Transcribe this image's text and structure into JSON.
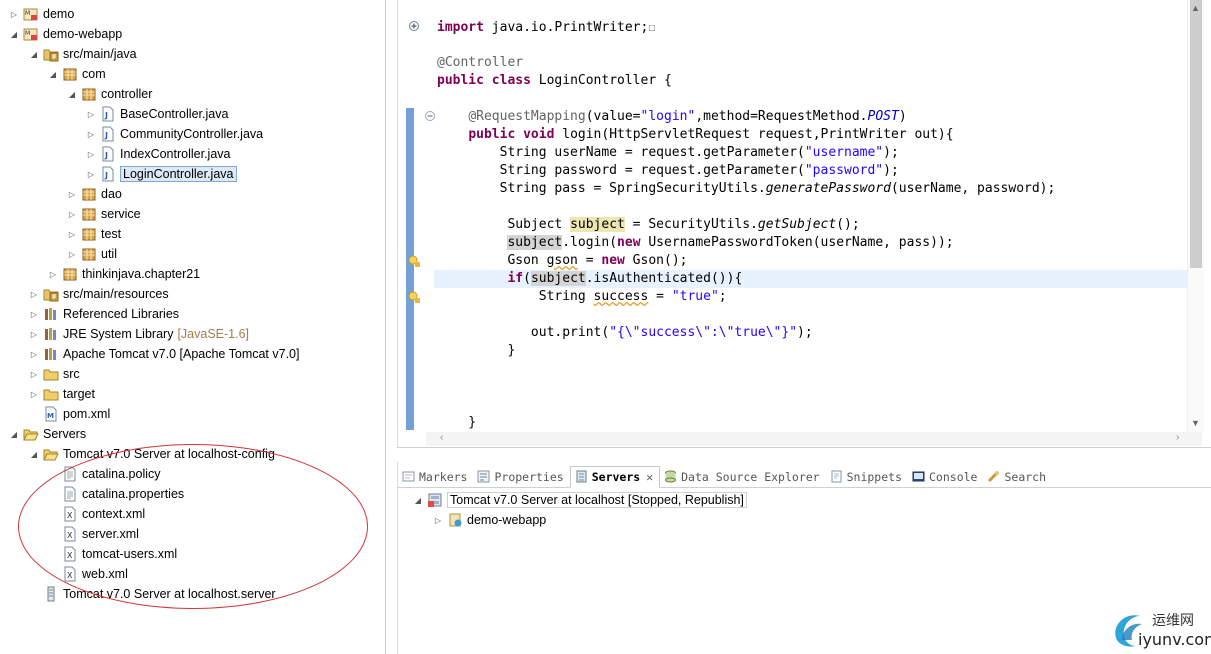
{
  "explorer": {
    "rows": [
      {
        "label": "demo",
        "indent": 0,
        "twisty": "collapsed",
        "icon": "maven-project-icon"
      },
      {
        "label": "demo-webapp",
        "indent": 0,
        "twisty": "expanded",
        "icon": "maven-project-icon"
      },
      {
        "label": "src/main/java",
        "indent": 1,
        "twisty": "expanded",
        "icon": "source-folder-icon"
      },
      {
        "label": "com",
        "indent": 2,
        "twisty": "expanded",
        "icon": "package-icon"
      },
      {
        "label": "controller",
        "indent": 3,
        "twisty": "expanded",
        "icon": "package-icon"
      },
      {
        "label": "BaseController.java",
        "indent": 4,
        "twisty": "collapsed",
        "icon": "java-file-icon"
      },
      {
        "label": "CommunityController.java",
        "indent": 4,
        "twisty": "collapsed",
        "icon": "java-file-icon"
      },
      {
        "label": "IndexController.java",
        "indent": 4,
        "twisty": "collapsed",
        "icon": "java-file-icon"
      },
      {
        "label": "LoginController.java",
        "indent": 4,
        "twisty": "collapsed",
        "icon": "java-file-icon",
        "selected": true
      },
      {
        "label": "dao",
        "indent": 3,
        "twisty": "collapsed",
        "icon": "package-icon"
      },
      {
        "label": "service",
        "indent": 3,
        "twisty": "collapsed",
        "icon": "package-icon"
      },
      {
        "label": "test",
        "indent": 3,
        "twisty": "collapsed",
        "icon": "package-icon"
      },
      {
        "label": "util",
        "indent": 3,
        "twisty": "collapsed",
        "icon": "package-icon"
      },
      {
        "label": "thinkinjava.chapter21",
        "indent": 2,
        "twisty": "collapsed",
        "icon": "package-icon"
      },
      {
        "label": "src/main/resources",
        "indent": 1,
        "twisty": "collapsed",
        "icon": "source-folder-icon"
      },
      {
        "label": "Referenced Libraries",
        "indent": 1,
        "twisty": "collapsed",
        "icon": "library-icon"
      },
      {
        "label": "JRE System Library",
        "decoration": "[JavaSE-1.6]",
        "indent": 1,
        "twisty": "collapsed",
        "icon": "library-icon"
      },
      {
        "label": "Apache Tomcat v7.0 [Apache Tomcat v7.0]",
        "indent": 1,
        "twisty": "collapsed",
        "icon": "library-icon"
      },
      {
        "label": "src",
        "indent": 1,
        "twisty": "collapsed",
        "icon": "folder-icon"
      },
      {
        "label": "target",
        "indent": 1,
        "twisty": "collapsed",
        "icon": "folder-icon"
      },
      {
        "label": "pom.xml",
        "indent": 1,
        "twisty": "none",
        "icon": "maven-pom-icon"
      },
      {
        "label": "Servers",
        "indent": 0,
        "twisty": "expanded",
        "icon": "open-folder-icon"
      },
      {
        "label": "Tomcat v7.0 Server at localhost-config",
        "indent": 1,
        "twisty": "expanded",
        "icon": "open-folder-icon"
      },
      {
        "label": "catalina.policy",
        "indent": 2,
        "twisty": "none",
        "icon": "text-file-icon"
      },
      {
        "label": "catalina.properties",
        "indent": 2,
        "twisty": "none",
        "icon": "text-file-icon"
      },
      {
        "label": "context.xml",
        "indent": 2,
        "twisty": "none",
        "icon": "xml-file-icon"
      },
      {
        "label": "server.xml",
        "indent": 2,
        "twisty": "none",
        "icon": "xml-file-icon"
      },
      {
        "label": "tomcat-users.xml",
        "indent": 2,
        "twisty": "none",
        "icon": "xml-file-icon"
      },
      {
        "label": "web.xml",
        "indent": 2,
        "twisty": "none",
        "icon": "xml-file-icon"
      },
      {
        "label": "Tomcat v7.0 Server at localhost.server",
        "indent": 1,
        "twisty": "none",
        "icon": "server-file-icon"
      }
    ]
  },
  "editor": {
    "lines": [
      [
        {
          "t": "import",
          "c": "kw"
        },
        {
          "t": " java.io.PrintWriter;"
        },
        {
          "t": "☐",
          "c": "fold"
        }
      ],
      [],
      [
        {
          "t": "@Controller",
          "c": "ann"
        }
      ],
      [
        {
          "t": "public",
          "c": "kw"
        },
        {
          "t": " "
        },
        {
          "t": "class",
          "c": "kw"
        },
        {
          "t": " LoginController {"
        }
      ],
      [],
      [
        {
          "t": "    "
        },
        {
          "t": "@RequestMapping",
          "c": "ann"
        },
        {
          "t": "(value="
        },
        {
          "t": "\"login\"",
          "c": "str"
        },
        {
          "t": ",method=RequestMethod."
        },
        {
          "t": "POST",
          "c": "const"
        },
        {
          "t": ")"
        }
      ],
      [
        {
          "t": "    "
        },
        {
          "t": "public",
          "c": "kw"
        },
        {
          "t": " "
        },
        {
          "t": "void",
          "c": "kw"
        },
        {
          "t": " login(HttpServletRequest request,PrintWriter out){"
        }
      ],
      [
        {
          "t": "        String userName = request.getParameter("
        },
        {
          "t": "\"username\"",
          "c": "str"
        },
        {
          "t": ");"
        }
      ],
      [
        {
          "t": "        String password = request.getParameter("
        },
        {
          "t": "\"password\"",
          "c": "str"
        },
        {
          "t": ");"
        }
      ],
      [
        {
          "t": "        String pass = SpringSecurityUtils."
        },
        {
          "t": "generatePassword",
          "c": "ital"
        },
        {
          "t": "(userName, password);"
        }
      ],
      [],
      [
        {
          "t": "         Subject "
        },
        {
          "t": "subject",
          "c": "hl"
        },
        {
          "t": " = SecurityUtils."
        },
        {
          "t": "getSubject",
          "c": "ital"
        },
        {
          "t": "();"
        }
      ],
      [
        {
          "t": "         "
        },
        {
          "t": "subject",
          "c": "hlg"
        },
        {
          "t": ".login("
        },
        {
          "t": "new",
          "c": "kw"
        },
        {
          "t": " UsernamePasswordToken(userName, pass));"
        }
      ],
      [
        {
          "t": "         Gson "
        },
        {
          "t": "gson",
          "c": "warn"
        },
        {
          "t": " = "
        },
        {
          "t": "new",
          "c": "kw"
        },
        {
          "t": " Gson();"
        }
      ],
      [
        {
          "t": "         "
        },
        {
          "t": "if",
          "c": "kw"
        },
        {
          "t": "("
        },
        {
          "t": "subject",
          "c": "hlg"
        },
        {
          "t": ".isAuthenticated()){"
        }
      ],
      [
        {
          "t": "             String "
        },
        {
          "t": "success",
          "c": "warn"
        },
        {
          "t": " = "
        },
        {
          "t": "\"true\"",
          "c": "str"
        },
        {
          "t": ";"
        }
      ],
      [],
      [
        {
          "t": "            out.print("
        },
        {
          "t": "\"{\\\"success\\\":\\\"true\\\"}\"",
          "c": "str"
        },
        {
          "t": ");"
        }
      ],
      [
        {
          "t": "         }"
        }
      ],
      [],
      [],
      [],
      [
        {
          "t": "    }"
        }
      ]
    ]
  },
  "views": {
    "tabs": [
      {
        "label": "Markers",
        "icon": "markers-icon"
      },
      {
        "label": "Properties",
        "icon": "properties-icon"
      },
      {
        "label": "Servers",
        "icon": "servers-icon",
        "active": true,
        "close": "✕"
      },
      {
        "label": "Data Source Explorer",
        "icon": "data-source-icon"
      },
      {
        "label": "Snippets",
        "icon": "snippets-icon"
      },
      {
        "label": "Console",
        "icon": "console-icon"
      },
      {
        "label": "Search",
        "icon": "search-icon"
      }
    ],
    "server": {
      "label": "Tomcat v7.0 Server at localhost  [Stopped, Republish]",
      "module": "demo-webapp"
    }
  },
  "watermark": {
    "cn": "运维网",
    "url": "iyunv.com"
  },
  "colors": {
    "selection": "#dde9f7",
    "change_bar": "#5d8fcc",
    "annotation": "#d23535",
    "keyword": "#7f0055",
    "string": "#2a00ff"
  }
}
